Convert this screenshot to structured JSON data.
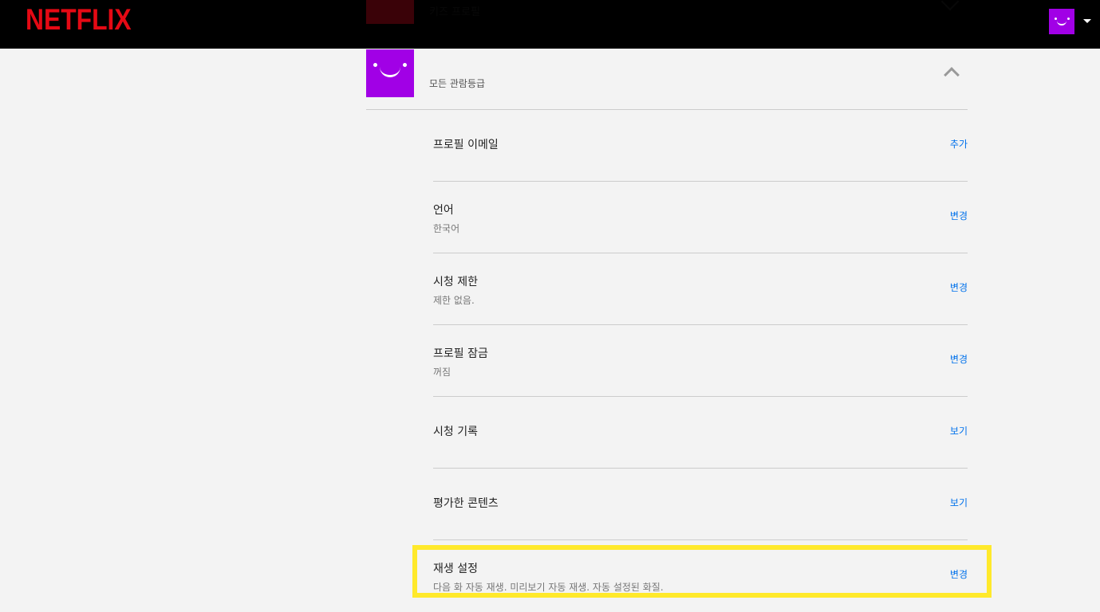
{
  "header": {
    "logo": "NETFLIX",
    "avatar": "smiley-avatar",
    "caret": "caret-down-icon"
  },
  "previous_profile": {
    "name": "키즈 프로필"
  },
  "profile": {
    "rating": "모든 관람등급",
    "avatar_color": "#a100e6"
  },
  "settings": [
    {
      "title": "프로필 이메일",
      "subtitle": "",
      "action": "추가"
    },
    {
      "title": "언어",
      "subtitle": "한국어",
      "action": "변경"
    },
    {
      "title": "시청 제한",
      "subtitle": "제한 없음.",
      "action": "변경"
    },
    {
      "title": "프로필 잠금",
      "subtitle": "꺼짐",
      "action": "변경"
    },
    {
      "title": "시청 기록",
      "subtitle": "",
      "action": "보기"
    },
    {
      "title": "평가한 콘텐츠",
      "subtitle": "",
      "action": "보기"
    },
    {
      "title": "재생 설정",
      "subtitle": "다음 화 자동 재생. 미리보기 자동 재생. 자동 설정된 화질.",
      "action": "변경"
    }
  ],
  "colors": {
    "brand": "#e50914",
    "link": "#0071eb",
    "highlight": "#ffe92b"
  }
}
